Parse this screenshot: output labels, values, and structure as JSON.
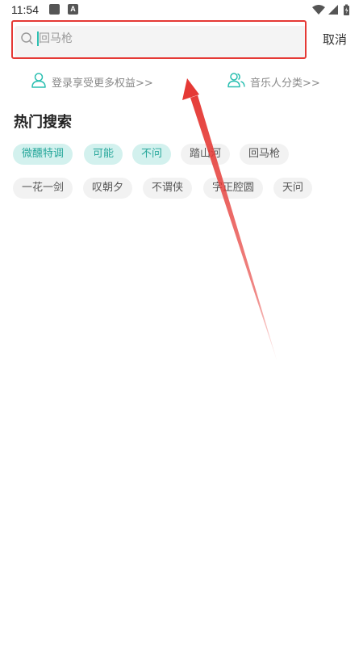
{
  "status_bar": {
    "time": "11:54",
    "badge_letter": "A"
  },
  "search": {
    "placeholder": "回马枪",
    "value": "",
    "cancel_label": "取消"
  },
  "links": {
    "login": "登录享受更多权益>>",
    "categories": "音乐人分类>>"
  },
  "hot": {
    "title": "热门搜索",
    "tags": [
      {
        "label": "微醺特调",
        "highlight": true
      },
      {
        "label": "可能",
        "highlight": true
      },
      {
        "label": "不问",
        "highlight": true
      },
      {
        "label": "踏山河",
        "highlight": false
      },
      {
        "label": "回马枪",
        "highlight": false
      },
      {
        "label": "一花一剑",
        "highlight": false
      },
      {
        "label": "叹朝夕",
        "highlight": false
      },
      {
        "label": "不谓侠",
        "highlight": false
      },
      {
        "label": "字正腔圆",
        "highlight": false
      },
      {
        "label": "天问",
        "highlight": false
      }
    ]
  },
  "colors": {
    "accent": "#2bbfb1",
    "highlight_tag_bg": "#d3f1ee",
    "annotation": "#e53935"
  }
}
